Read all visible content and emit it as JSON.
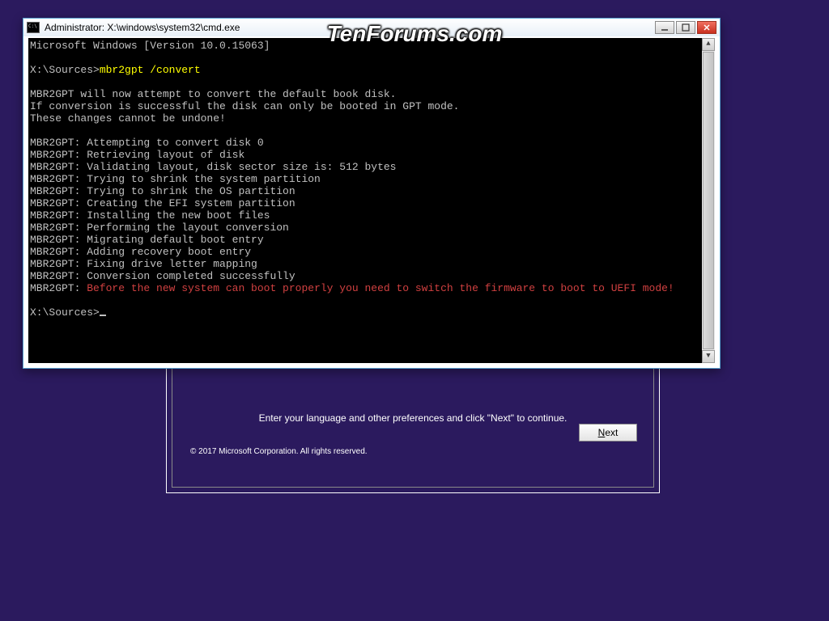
{
  "watermark": "TenForums.com",
  "setup": {
    "prompt": "Enter your language and other preferences and click \"Next\" to continue.",
    "copyright": "© 2017 Microsoft Corporation. All rights reserved.",
    "next_label": "Next"
  },
  "cmd": {
    "title": "Administrator: X:\\windows\\system32\\cmd.exe",
    "version_line": "Microsoft Windows [Version 10.0.15063]",
    "prompt1_path": "X:\\Sources>",
    "prompt1_cmd": "mbr2gpt /convert",
    "out": [
      "MBR2GPT will now attempt to convert the default book disk.",
      "If conversion is successful the disk can only be booted in GPT mode.",
      "These changes cannot be undone!",
      "",
      "MBR2GPT: Attempting to convert disk 0",
      "MBR2GPT: Retrieving layout of disk",
      "MBR2GPT: Validating layout, disk sector size is: 512 bytes",
      "MBR2GPT: Trying to shrink the system partition",
      "MBR2GPT: Trying to shrink the OS partition",
      "MBR2GPT: Creating the EFI system partition",
      "MBR2GPT: Installing the new boot files",
      "MBR2GPT: Performing the layout conversion",
      "MBR2GPT: Migrating default boot entry",
      "MBR2GPT: Adding recovery boot entry",
      "MBR2GPT: Fixing drive letter mapping",
      "MBR2GPT: Conversion completed successfully"
    ],
    "warn_prefix": "MBR2GPT: ",
    "warn_text": "Before the new system can boot properly you need to switch the firmware to boot to UEFI mode!",
    "prompt2_path": "X:\\Sources>"
  }
}
